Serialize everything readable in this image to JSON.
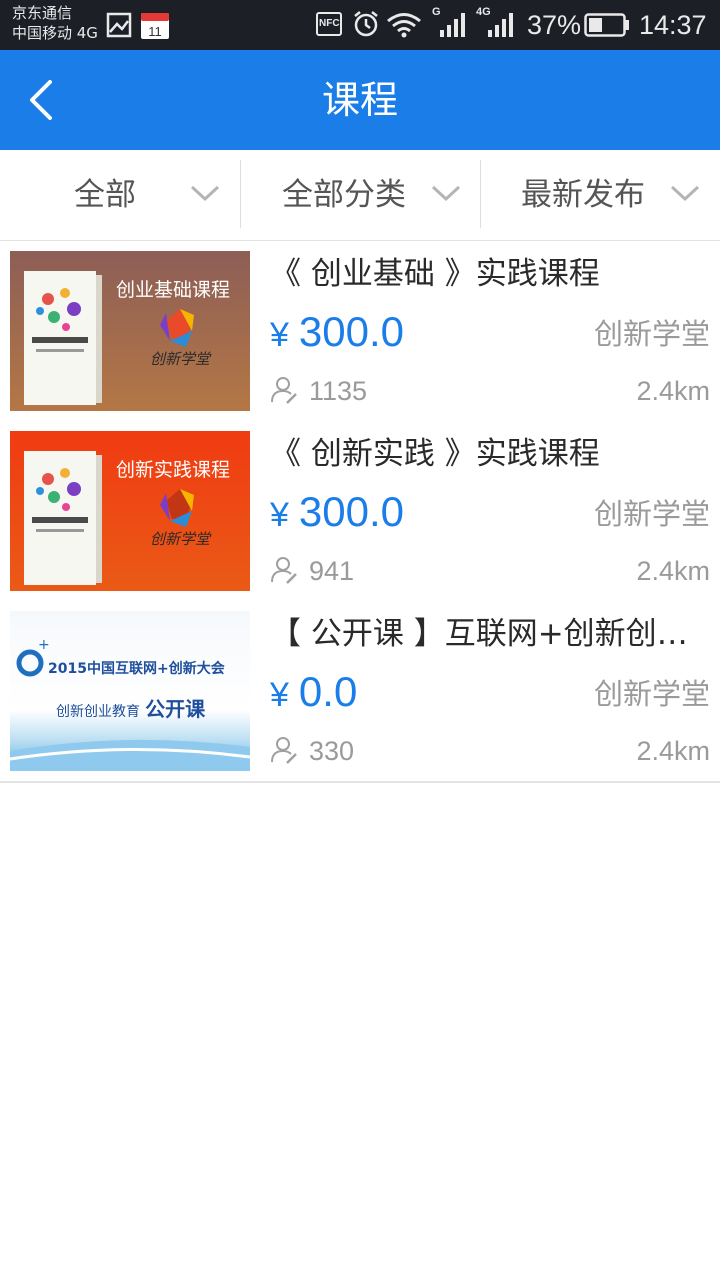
{
  "status_bar": {
    "carrier_line1": "京东通信",
    "carrier_line2": "中国移动 4G",
    "calendar_day": "11",
    "nfc": "NFC",
    "signal1_label": "G",
    "signal2_label": "4G",
    "battery": "37%",
    "time": "14:37"
  },
  "header": {
    "title": "课程"
  },
  "filters": [
    {
      "label": "全部"
    },
    {
      "label": "全部分类"
    },
    {
      "label": "最新发布"
    }
  ],
  "courses": [
    {
      "name": "《 创业基础 》实践课程",
      "currency": "¥",
      "price": "300.0",
      "org": "创新学堂",
      "count": "1135",
      "distance": "2.4km",
      "thumb_title": "创业基础课程",
      "thumb_brand": "创新学堂",
      "thumb_color": "#a86a48"
    },
    {
      "name": "《 创新实践 》实践课程",
      "currency": "¥",
      "price": "300.0",
      "org": "创新学堂",
      "count": "941",
      "distance": "2.4km",
      "thumb_title": "创新实践课程",
      "thumb_brand": "创新学堂",
      "thumb_color": "#ee4a12"
    },
    {
      "name": "【 公开课 】互联网+创新创业...",
      "currency": "¥",
      "price": "0.0",
      "org": "创新学堂",
      "count": "330",
      "distance": "2.4km",
      "thumb_title": "2015中国互联网+创新大会",
      "thumb_sub": "创新创业教育",
      "thumb_tag": "公开课"
    }
  ],
  "colors": {
    "accent": "#1a7de8",
    "header_bg": "#1a7de8",
    "status_bg": "#1c1f26"
  }
}
